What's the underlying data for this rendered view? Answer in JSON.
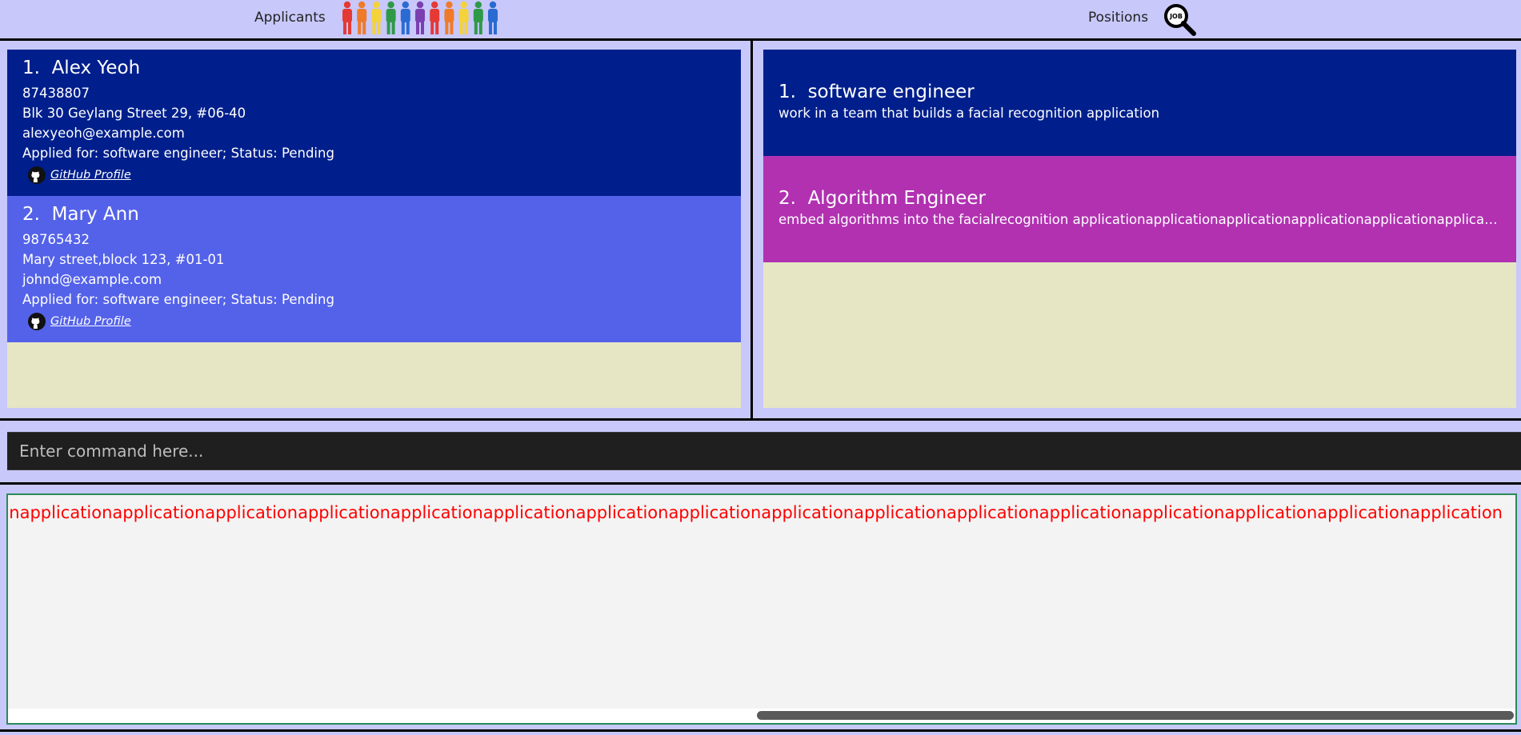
{
  "header": {
    "applicants_title": "Applicants",
    "positions_title": "Positions",
    "job_icon_text": "JOB",
    "people_colors": [
      "#e53935",
      "#ef7b2a",
      "#f4d23a",
      "#2e9a47",
      "#2a6bd1",
      "#7b3fb0",
      "#e53935",
      "#ef7b2a",
      "#f4d23a",
      "#2e9a47",
      "#2a6bd1"
    ]
  },
  "applicants": [
    {
      "index": "1.",
      "name": "Alex Yeoh",
      "phone": "87438807",
      "address": "Blk 30 Geylang Street 29, #06-40",
      "email": "alexyeoh@example.com",
      "applied": "Applied for: software engineer; Status: Pending",
      "github_label": "GitHub Profile",
      "bg": "#001f8c"
    },
    {
      "index": "2.",
      "name": "Mary Ann",
      "phone": "98765432",
      "address": "Mary street,block 123, #01-01",
      "email": "johnd@example.com",
      "applied": "Applied for: software engineer; Status: Pending",
      "github_label": "GitHub Profile",
      "bg": "#5462e9"
    }
  ],
  "positions": [
    {
      "index": "1.",
      "title": "software engineer",
      "description": "work in a team that builds a facial recognition application",
      "bg": "#001f8c"
    },
    {
      "index": "2.",
      "title": "Algorithm Engineer",
      "description": "embed algorithms into the facialrecognition applicationapplicationapplicationapplicationapplicationapplicationapplicationapplication",
      "bg": "#b131b1"
    }
  ],
  "command": {
    "placeholder": "Enter command here..."
  },
  "result": {
    "text": "ationapplicationapplicationapplicationapplicationapplicationapplicationapplicationapplicationapplicationapplicationapplicationapplicationapplicationapplicationapplicationapplicationapplication",
    "color": "#ff0000"
  }
}
